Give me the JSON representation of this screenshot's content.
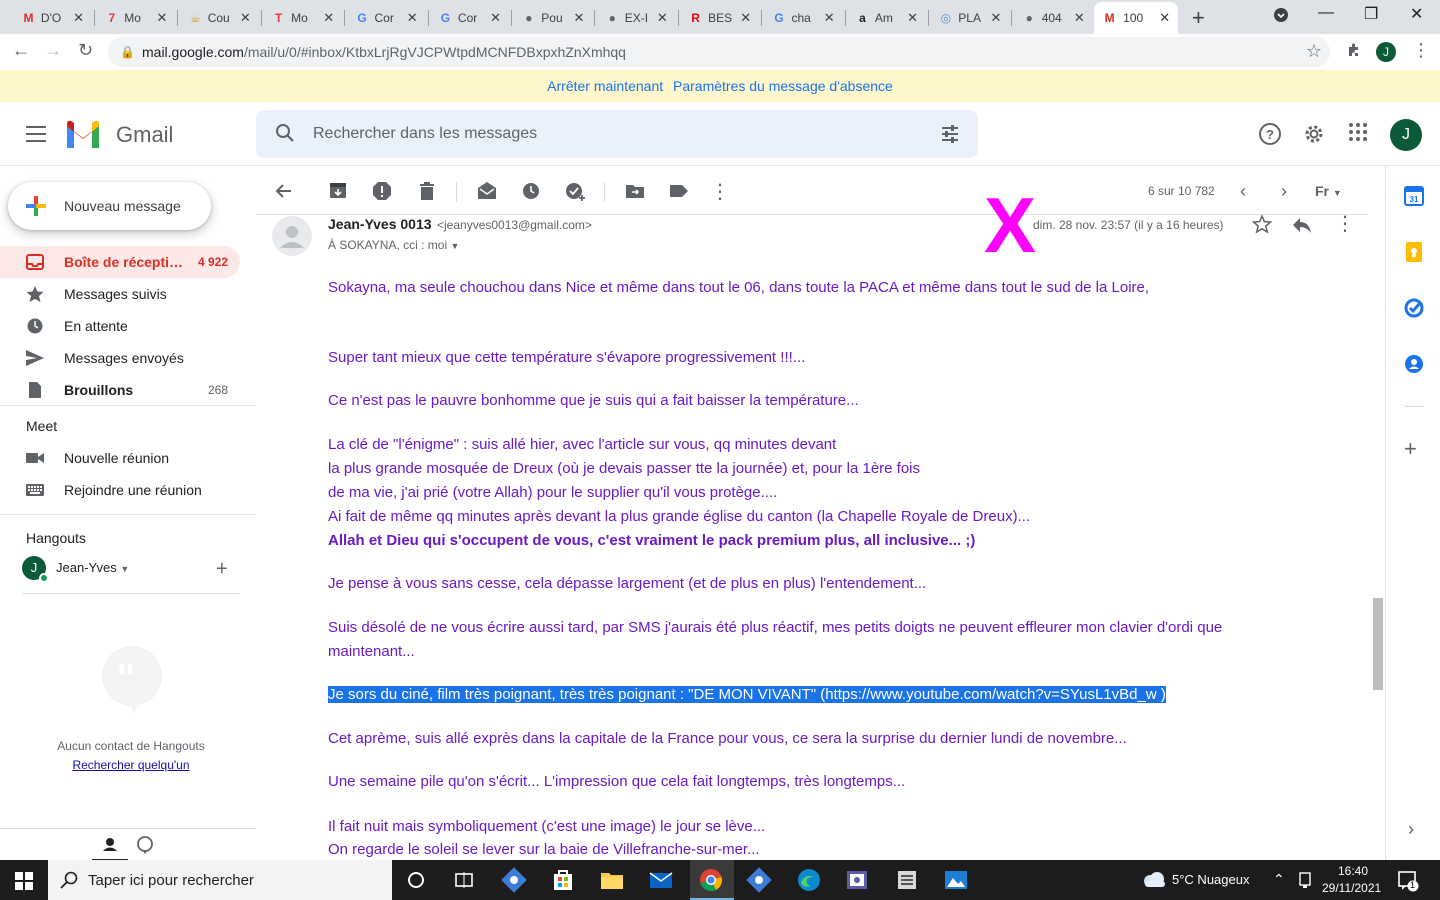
{
  "browser": {
    "tabs": [
      {
        "title": "D'O",
        "fav": "M",
        "favcolor": "#d93025"
      },
      {
        "title": "Mo",
        "fav": "7",
        "favcolor": "#e53935"
      },
      {
        "title": "Cou",
        "fav": "☕",
        "favcolor": "#c9a227"
      },
      {
        "title": "Mo",
        "fav": "T",
        "favcolor": "#e53935"
      },
      {
        "title": "Cor",
        "fav": "G",
        "favcolor": "#4285f4"
      },
      {
        "title": "Cor",
        "fav": "G",
        "favcolor": "#4285f4"
      },
      {
        "title": "Pou",
        "fav": "●",
        "favcolor": "#5f6368"
      },
      {
        "title": "EX-I",
        "fav": "●",
        "favcolor": "#5f6368"
      },
      {
        "title": "BES",
        "fav": "R",
        "favcolor": "#e30613"
      },
      {
        "title": "cha",
        "fav": "G",
        "favcolor": "#4285f4"
      },
      {
        "title": "Am",
        "fav": "a",
        "favcolor": "#202124"
      },
      {
        "title": "PLA",
        "fav": "◎",
        "favcolor": "#5b8fd6"
      },
      {
        "title": "404",
        "fav": "●",
        "favcolor": "#5f6368"
      },
      {
        "title": "100",
        "fav": "M",
        "favcolor": "#d93025"
      }
    ],
    "url_host": "mail.google.com",
    "url_path": "/mail/u/0/#inbox/KtbxLrjRgVJCPWtpdMCNFDBxpxhZnXmhqq",
    "profile_initial": "J"
  },
  "banner": {
    "stop": "Arrêter maintenant",
    "settings": "Paramètres du message d'absence"
  },
  "header": {
    "app_name": "Gmail",
    "search_placeholder": "Rechercher dans les messages",
    "avatar_initial": "J"
  },
  "sidebar": {
    "compose_label": "Nouveau message",
    "items": [
      {
        "label": "Boîte de récepti…",
        "count": "4 922"
      },
      {
        "label": "Messages suivis",
        "count": ""
      },
      {
        "label": "En attente",
        "count": ""
      },
      {
        "label": "Messages envoyés",
        "count": ""
      },
      {
        "label": "Brouillons",
        "count": "268"
      }
    ],
    "meet_title": "Meet",
    "meet_items": [
      "Nouvelle réunion",
      "Rejoindre une réunion"
    ],
    "hangouts_title": "Hangouts",
    "hangouts_user": "Jean-Yves",
    "hangouts_user_initial": "J",
    "no_contact": "Aucun contact de Hangouts",
    "search_someone": "Rechercher quelqu'un"
  },
  "toolbar": {
    "pager": "6 sur 10 782",
    "lang": "Fr"
  },
  "message": {
    "sender_name": "Jean-Yves 0013",
    "sender_email": "<jeanyves0013@gmail.com>",
    "recipients": "À SOKAYNA, cci : moi",
    "datetime": "dim. 28 nov. 23:57 (il y a 16 heures)",
    "overlay_mark": "X",
    "lines": [
      "Sokayna, ma seule chouchou dans Nice et même dans tout le 06, dans toute la PACA et même dans tout le sud de la Loire,",
      "Super tant mieux que cette température s'évapore progressivement !!!...",
      "Ce n'est pas le pauvre bonhomme que je suis qui a fait baisser la température...",
      "La clé de \"l'énigme\" : suis allé hier, avec l'article sur vous, qq minutes devant",
      "la plus grande mosquée de Dreux (où je devais passer tte la journée) et, pour la 1ère fois",
      "de ma vie, j'ai prié (votre Allah) pour le supplier qu'il vous protège....",
      "Ai fait de même qq minutes après devant la plus grande église du canton (la Chapelle Royale de Dreux)...",
      "Allah et Dieu qui s'occupent de vous, c'est vraiment le pack premium plus,  all inclusive...   ;)",
      "Je pense à vous sans cesse, cela dépasse largement (et de plus en plus) l'entendement...",
      "Suis désolé de ne vous écrire aussi tard, par SMS j'aurais été plus réactif, mes petits doigts ne peuvent effleurer mon clavier d'ordi que",
      "maintenant...",
      "Je sors du ciné, film très poignant, très très poignant : \"DE MON VIVANT\" (https://www.youtube.com/watch?v=SYusL1vBd_w )",
      "Cet aprème, suis allé exprès dans la capitale de la France pour vous, ce sera la surprise du dernier lundi de novembre...",
      "Une semaine pile qu'on s'écrit... L'impression que cela fait longtemps, très longtemps...",
      "Il fait nuit mais symboliquement (c'est une image) le jour se lève...",
      "On regarde le soleil se lever sur la baie de Villefranche-sur-mer..."
    ]
  },
  "taskbar": {
    "search_placeholder": "Taper ici pour rechercher",
    "weather": "5°C  Nuageux",
    "time": "16:40",
    "date": "29/11/2021",
    "notif_count": "1"
  },
  "colors": {
    "body_text": "#6a1ac8",
    "selection": "#1a73e8",
    "overlay_mark": "#ff00ff",
    "banner_bg": "#fef7cc",
    "inbox_active_bg": "#fce8e6"
  }
}
